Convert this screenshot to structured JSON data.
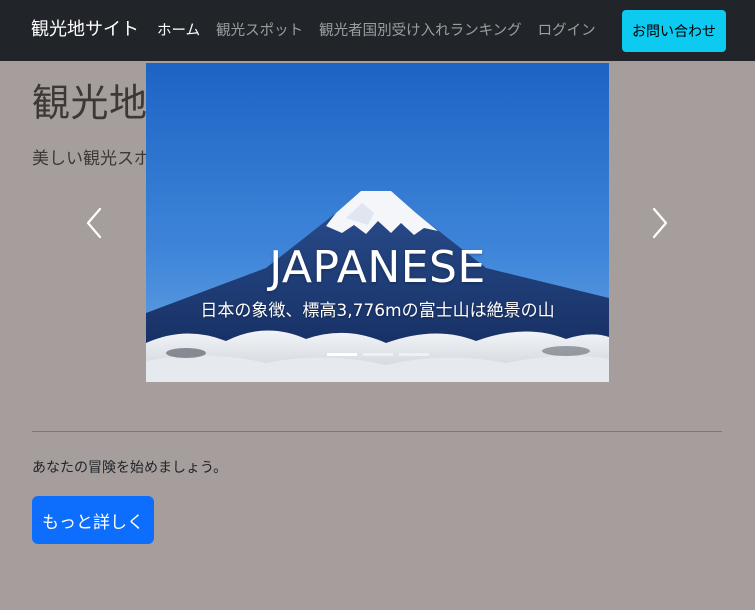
{
  "navbar": {
    "brand": "観光地サイト",
    "links": [
      {
        "label": "ホーム",
        "active": true
      },
      {
        "label": "観光スポット",
        "active": false
      },
      {
        "label": "観光者国別受け入れランキング",
        "active": false
      },
      {
        "label": "ログイン",
        "active": false
      }
    ],
    "contact_label": "お問い合わせ"
  },
  "hero": {
    "title": "観光地へようこそ",
    "lead": "美しい観光スポットを探索しましょう。",
    "cta_text": "あなたの冒険を始めましょう。",
    "cta_button": "もっと詳しく"
  },
  "carousel": {
    "caption_title": "JAPANESE",
    "caption_text": "日本の象徴、標高3,776mの富士山は絶景の山",
    "slide_count": 3,
    "active_index": 0,
    "prev_icon": "chevron-left-icon",
    "next_icon": "chevron-right-icon"
  },
  "colors": {
    "navbar_bg": "#212529",
    "page_bg": "#a59e9c",
    "contact_button": "#0dcaf0",
    "primary_button": "#0d6efd"
  }
}
